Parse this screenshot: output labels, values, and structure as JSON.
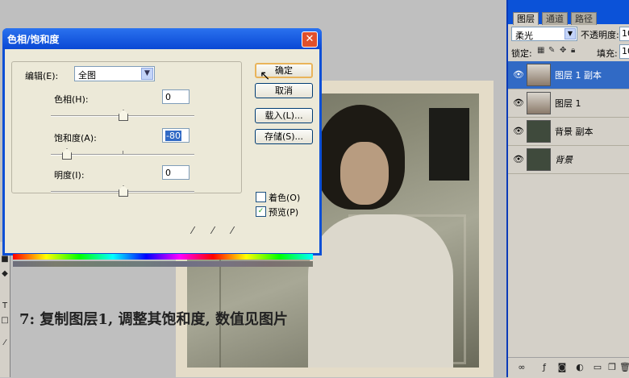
{
  "dialog": {
    "title": "色相/饱和度",
    "close_icon": "close-icon",
    "edit_label": "编辑(E):",
    "edit_value": "全图",
    "hue_label": "色相(H):",
    "hue_value": "0",
    "saturation_label": "饱和度(A):",
    "saturation_value": "-80",
    "lightness_label": "明度(I):",
    "lightness_value": "0",
    "buttons": {
      "ok": "确定",
      "cancel": "取消",
      "load": "载入(L)...",
      "save": "存储(S)..."
    },
    "colorize_label": "着色(O)",
    "colorize_checked": false,
    "preview_label": "预览(P)",
    "preview_checked": true
  },
  "caption": "7: 复制图层1, 调整其饱和度, 数值见图片",
  "layers_panel": {
    "tabs": [
      "图层",
      "通道",
      "路径"
    ],
    "blend_mode": "柔光",
    "opacity_label": "不透明度:",
    "opacity_value": "10",
    "lock_label": "锁定:",
    "fill_label": "填充:",
    "fill_value": "10",
    "layers": [
      {
        "name": "图层 1 副本",
        "selected": true,
        "thumb": "portrait"
      },
      {
        "name": "图层 1",
        "selected": false,
        "thumb": "portrait"
      },
      {
        "name": "背景 副本",
        "selected": false,
        "thumb": "dark-green"
      },
      {
        "name": "背景",
        "selected": false,
        "thumb": "dark-green"
      }
    ]
  },
  "colors": {
    "titlebar": "#0a48d4",
    "dialog_bg": "#ece9d8",
    "selected_layer": "#316ac5"
  }
}
